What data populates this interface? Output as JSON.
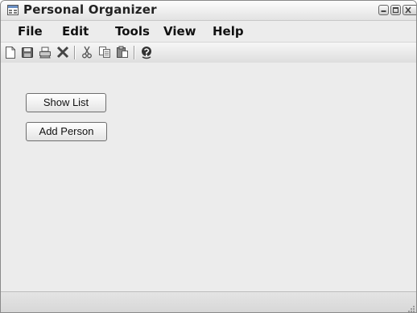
{
  "window": {
    "title": "Personal Organizer",
    "app_icon": "window-app-icon",
    "controls": [
      "minimize-icon",
      "maximize-icon",
      "close-icon"
    ]
  },
  "menu": {
    "items": [
      "File",
      "Edit",
      "Tools",
      "View",
      "Help"
    ]
  },
  "toolbar": {
    "buttons": [
      "new-document-icon",
      "save-icon",
      "print-icon",
      "delete-icon",
      "cut-icon",
      "copy-icon",
      "paste-icon",
      "help-icon"
    ]
  },
  "content": {
    "show_list_label": "Show List",
    "add_person_label": "Add Person"
  },
  "colors": {
    "window_background": "#ececec",
    "title_text": "#222222",
    "delete_icon": "#444444"
  }
}
